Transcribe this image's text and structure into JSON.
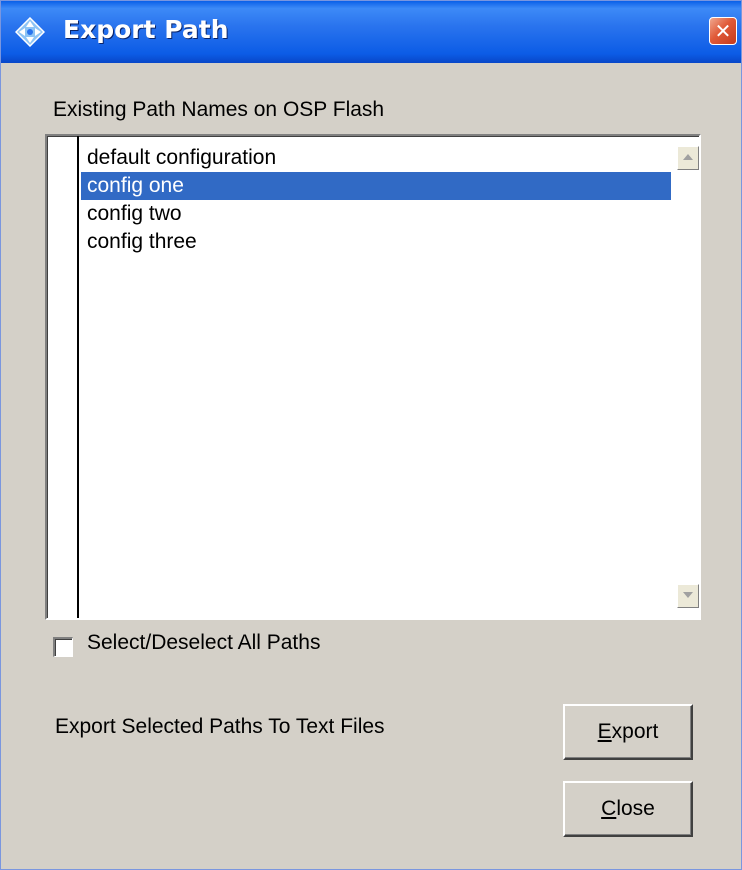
{
  "window": {
    "title": "Export Path",
    "title_icon": "diamond-arrows-icon",
    "close_icon": "close-x-icon"
  },
  "paths_group": {
    "label": "Existing Path Names on OSP Flash",
    "items": [
      {
        "label": "default configuration",
        "selected": false
      },
      {
        "label": "config one",
        "selected": true
      },
      {
        "label": "config two",
        "selected": false
      },
      {
        "label": "config three",
        "selected": false
      }
    ]
  },
  "select_all": {
    "label": "Select/Deselect All Paths",
    "checked": false
  },
  "export_section": {
    "label": "Export Selected Paths To Text Files"
  },
  "buttons": {
    "export": {
      "mnemonic": "E",
      "rest": "xport"
    },
    "close": {
      "mnemonic": "C",
      "rest": "lose"
    }
  },
  "colors": {
    "titlebar": "#0c5ce6",
    "dialog_bg": "#d4d0c8",
    "selection": "#316ac5",
    "close_button": "#e05a38"
  }
}
